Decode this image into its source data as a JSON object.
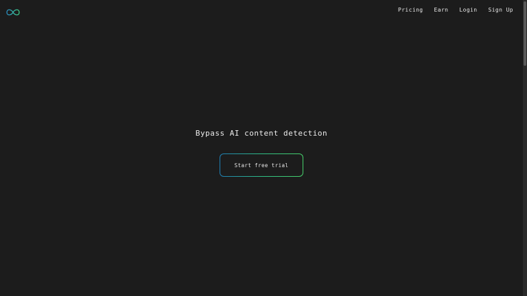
{
  "header": {
    "logo_icon": "infinity-icon",
    "nav": [
      {
        "label": "Pricing"
      },
      {
        "label": "Earn"
      },
      {
        "label": "Login"
      },
      {
        "label": "Sign Up"
      }
    ]
  },
  "hero": {
    "title": "Bypass AI content detection",
    "cta_label": "Start free trial"
  },
  "colors": {
    "background": "#1c1c1c",
    "accent_start": "#1f7fb6",
    "accent_end": "#47d16b"
  }
}
